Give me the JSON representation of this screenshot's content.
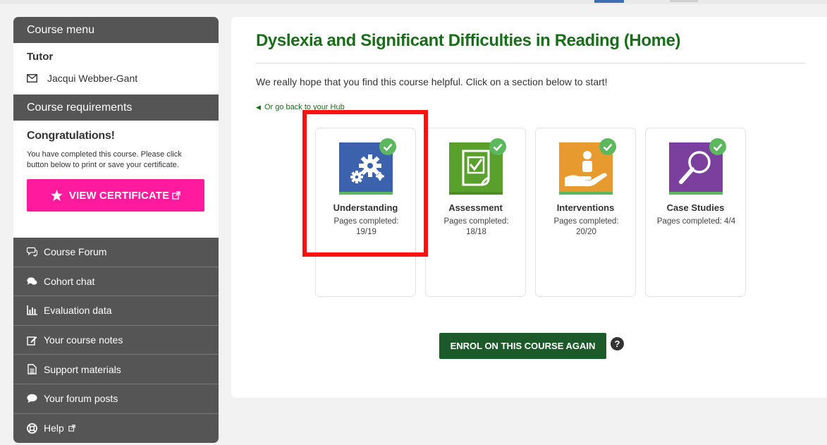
{
  "sidebar": {
    "course_menu": "Course menu",
    "tutor_title": "Tutor",
    "tutor_name": "Jacqui Webber-Gant",
    "requirements": "Course requirements",
    "congrats_title": "Congratulations!",
    "congrats_text": "You have completed this course. Please click button below to print or save your certificate.",
    "certificate_button": "VIEW CERTIFICATE",
    "items": [
      {
        "label": "Course Forum",
        "icon": "forum-icon"
      },
      {
        "label": "Cohort chat",
        "icon": "chat-icon"
      },
      {
        "label": "Evaluation data",
        "icon": "bar-chart-icon"
      },
      {
        "label": "Your course notes",
        "icon": "edit-icon"
      },
      {
        "label": "Support materials",
        "icon": "document-icon"
      },
      {
        "label": "Your forum posts",
        "icon": "comment-icon"
      },
      {
        "label": "Help",
        "icon": "lifebuoy-icon"
      }
    ]
  },
  "main": {
    "title": "Dyslexia and Significant Difficulties in Reading (Home)",
    "intro": "We really hope that you find this course helpful. Click on a section below to start!",
    "back_link": "Or go back to your Hub",
    "cards": [
      {
        "name": "Understanding",
        "pages": "Pages completed: 19/19",
        "icon": "gears-icon",
        "color": "#3d62ad"
      },
      {
        "name": "Assessment",
        "pages": "Pages completed: 18/18",
        "icon": "checkbox-doc-icon",
        "color": "#5aa02c"
      },
      {
        "name": "Interventions",
        "pages": "Pages completed: 20/20",
        "icon": "hand-person-icon",
        "color": "#e79b2f"
      },
      {
        "name": "Case Studies",
        "pages": "Pages completed: 4/4",
        "icon": "magnifier-icon",
        "color": "#7b3f9e"
      }
    ],
    "enrol_button": "ENROL ON THIS COURSE AGAIN",
    "help_glyph": "?"
  },
  "colors": {
    "title_green": "#1a6e1a",
    "certificate_pink": "#ff1a9e",
    "sidebar_dark": "#555555",
    "enrol_green": "#1d5a2a",
    "highlight_red": "#ff1111",
    "check_green": "#5cb85c"
  }
}
